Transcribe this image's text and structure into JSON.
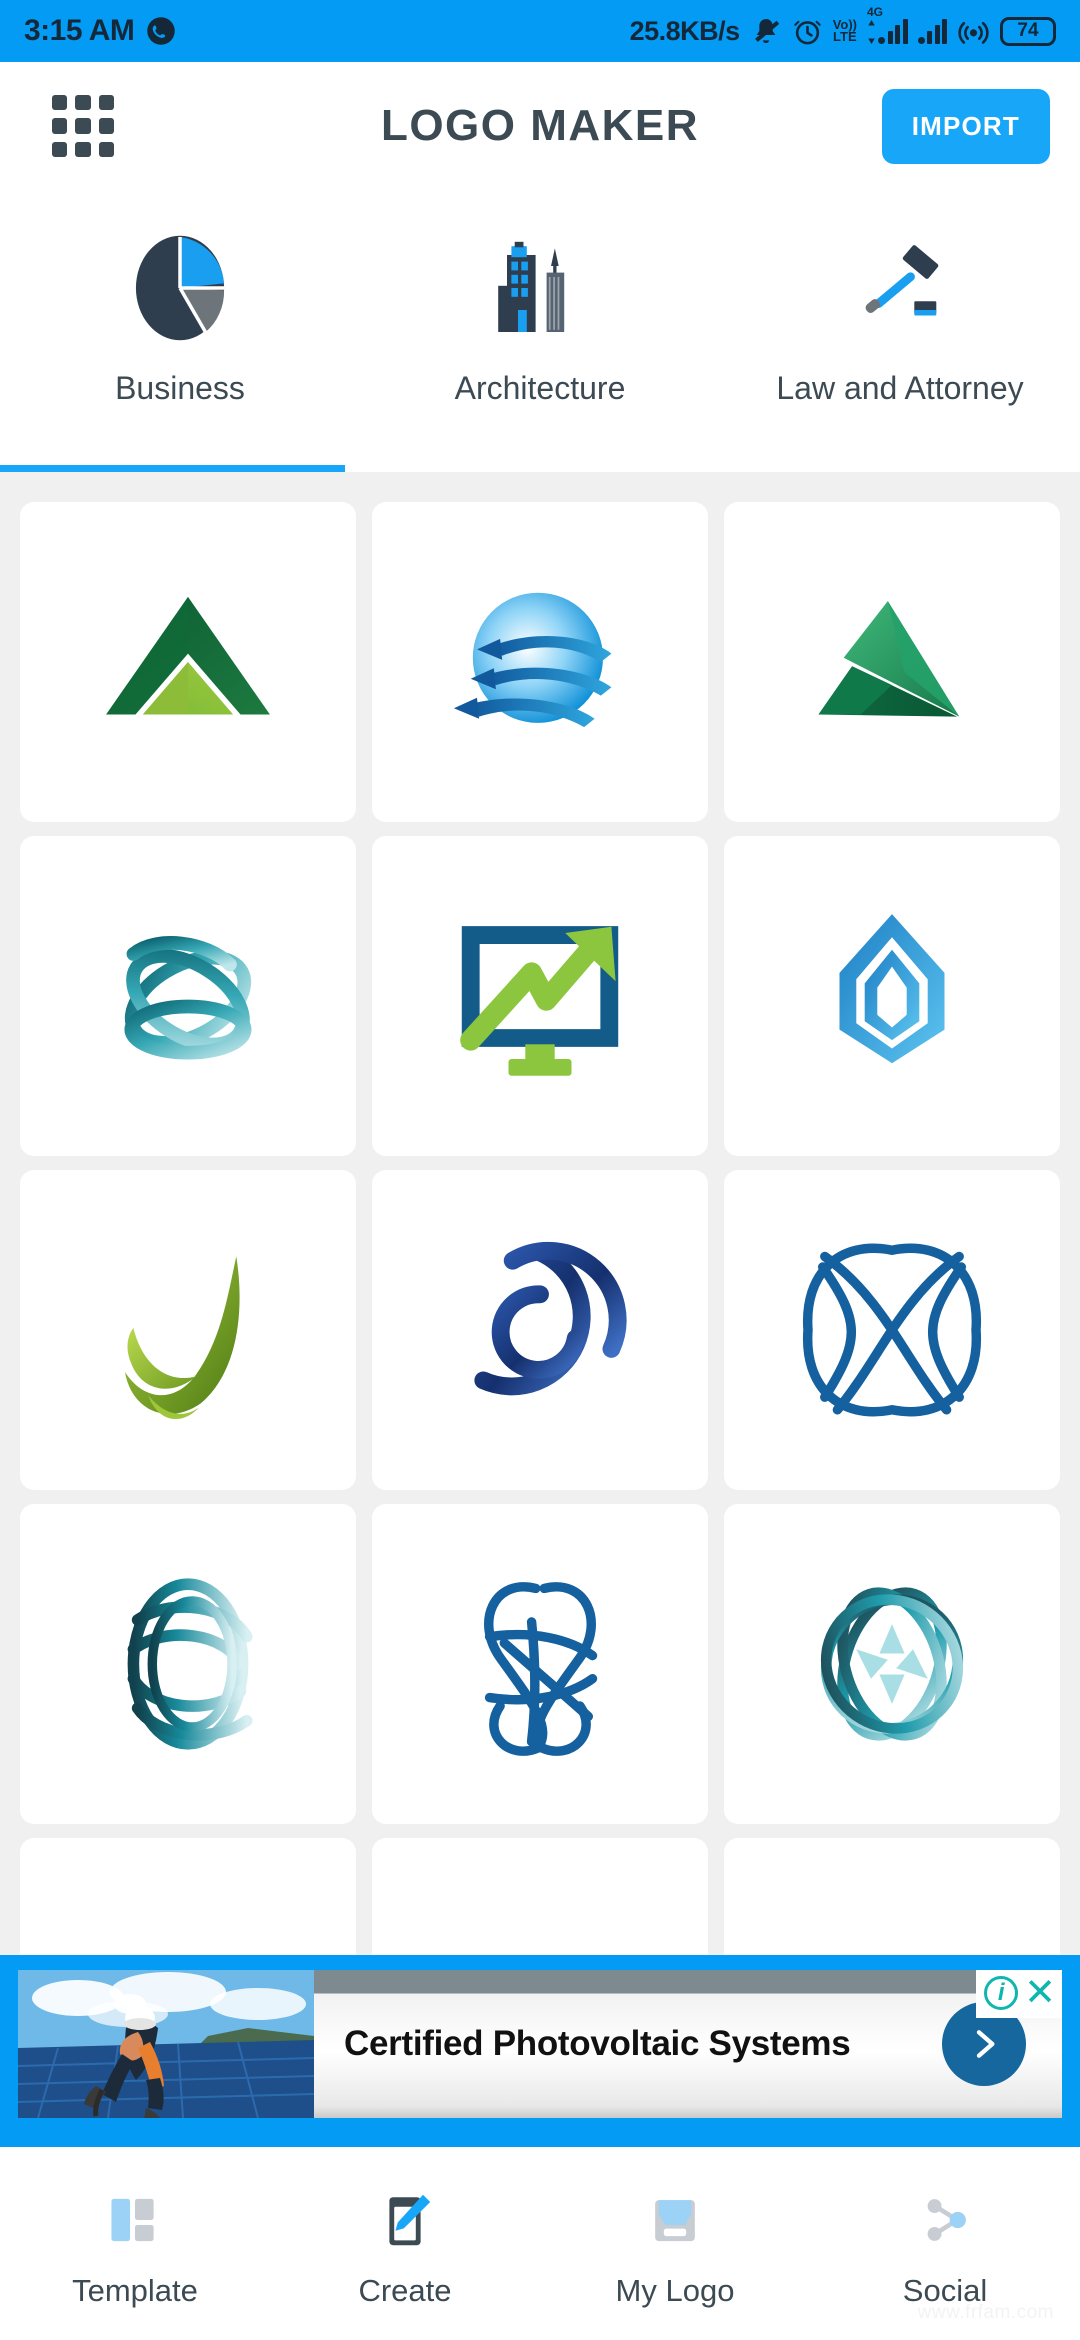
{
  "status_bar": {
    "time": "3:15 AM",
    "network_speed": "25.8KB/s",
    "battery_level": "74",
    "volte_top": "Vo))",
    "volte_bottom": "LTE",
    "network_type": "4G",
    "icons": [
      "whatsapp-icon",
      "bell-muted-icon",
      "alarm-clock-icon",
      "volte-icon",
      "signal-bars-icon",
      "signal-bars-2-icon",
      "hotspot-icon",
      "battery-icon"
    ],
    "background_color": "#039BF4"
  },
  "header": {
    "title": "LOGO MAKER",
    "menu_icon": "grid-menu-icon",
    "import_label": "IMPORT",
    "accent_color": "#18A6F8",
    "title_color": "#3c4a53"
  },
  "categories": {
    "active_index": 0,
    "items": [
      {
        "label": "Business",
        "icon": "pie-chart-icon"
      },
      {
        "label": "Architecture",
        "icon": "city-buildings-icon"
      },
      {
        "label": "Law and Attorney",
        "icon": "gavel-icon"
      }
    ]
  },
  "logo_grid": {
    "rows": [
      [
        {
          "name": "green-mountain-triangle-logo"
        },
        {
          "name": "blue-globe-arrows-logo"
        },
        {
          "name": "green-pyramid-facets-logo"
        }
      ],
      [
        {
          "name": "teal-ribbon-orbit-logo"
        },
        {
          "name": "monitor-growth-chart-logo"
        },
        {
          "name": "blue-diamond-shield-logo"
        }
      ],
      [
        {
          "name": "green-leaf-swoosh-logo"
        },
        {
          "name": "blue-spiral-circles-logo"
        },
        {
          "name": "blue-crossed-loops-logo"
        }
      ],
      [
        {
          "name": "teal-sphere-stripes-logo"
        },
        {
          "name": "blue-knot-loops-logo"
        },
        {
          "name": "teal-sphere-rings-logo"
        }
      ],
      [
        {
          "name": "partial-card-1"
        },
        {
          "name": "partial-card-2"
        },
        {
          "name": "partial-card-3"
        }
      ]
    ]
  },
  "ad": {
    "title": "Certified Photovoltaic Systems",
    "adchoices_label": "i",
    "close_label": "✕",
    "cta_icon": "chevron-right-icon",
    "image_alt": "solar-panel-worker-photo"
  },
  "bottom_nav": {
    "items": [
      {
        "label": "Template",
        "icon": "template-layout-icon"
      },
      {
        "label": "Create",
        "icon": "edit-pencil-icon"
      },
      {
        "label": "My Logo",
        "icon": "save-folder-icon"
      },
      {
        "label": "Social",
        "icon": "share-network-icon"
      }
    ]
  },
  "watermark": "www.frfam.com"
}
